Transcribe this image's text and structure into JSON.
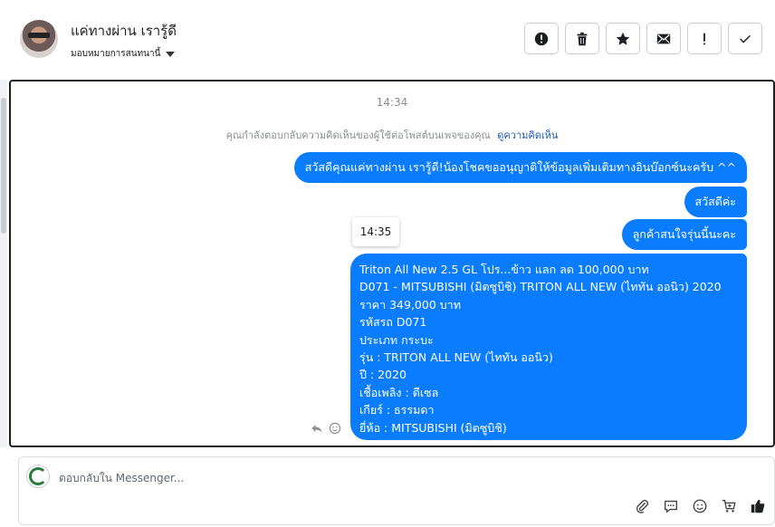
{
  "header": {
    "user_name": "แค่ทางผ่าน เรารู้ดี",
    "assign_label": "มอบหมายการสนทนานี้",
    "actions": [
      {
        "icon": "alert-circle-icon"
      },
      {
        "icon": "trash-icon"
      },
      {
        "icon": "star-icon"
      },
      {
        "icon": "mail-icon"
      },
      {
        "icon": "exclamation-icon"
      },
      {
        "icon": "check-icon"
      }
    ]
  },
  "thread": {
    "timestamp": "14:34",
    "notice_text": "คุณกำลังตอบกลับความคิดเห็นของผู้ใช้ต่อโพสต์บนเพจของคุณ",
    "notice_link": "ดูความคิดเห็น",
    "tooltip_time": "14:35",
    "messages": [
      "สวัสดีคุณแค่ทางผ่าน เรารู้ดี!น้องโชคขออนุญาติให้ข้อมูลเพิ่มเติมทางอินบ๊อกซ์นะครับ ^^",
      "สวัสดีค่ะ",
      "ลูกค้าสนใจรุ่นนี้นะคะ"
    ],
    "detail_lines": [
      "Triton All New 2.5 GL โปร...ข้าว แลก ลด 100,000 บาท",
      "D071 - MITSUBISHI (มิตซูบิชิ) TRITON ALL NEW (ไททัน ออนิว) 2020",
      "ราคา 349,000 บาท",
      "รหัสรถ D071",
      "ประเภท กระบะ",
      "รุ่น : TRITON ALL NEW (ไททัน ออนิว)",
      "ปี : 2020",
      "เชื้อเพลิง : ดีเซล",
      "เกียร์ : ธรรมดา",
      "ยี่ห้อ : MITSUBISHI (มิตซูบิชิ)"
    ]
  },
  "composer": {
    "placeholder": "ตอบกลับใน Messenger..."
  },
  "colors": {
    "bubble": "#0a7cff",
    "link": "#1a5bb8"
  }
}
